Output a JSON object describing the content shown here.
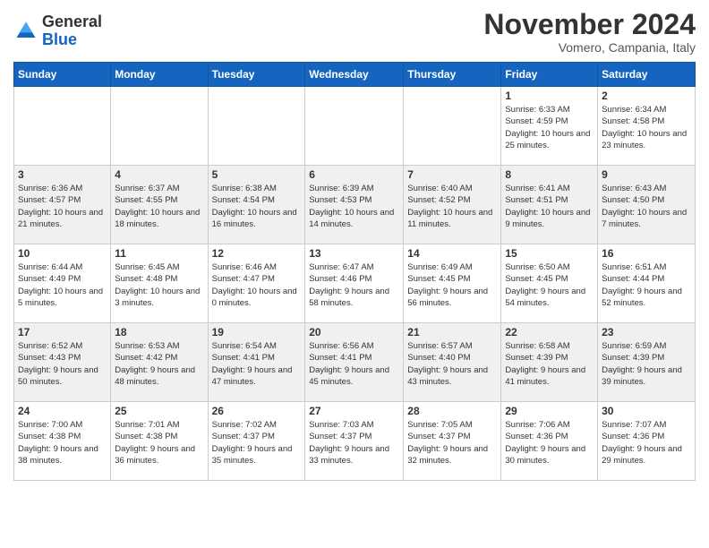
{
  "header": {
    "logo_line1": "General",
    "logo_line2": "Blue",
    "month": "November 2024",
    "location": "Vomero, Campania, Italy"
  },
  "weekdays": [
    "Sunday",
    "Monday",
    "Tuesday",
    "Wednesday",
    "Thursday",
    "Friday",
    "Saturday"
  ],
  "weeks": [
    [
      {
        "day": "",
        "info": ""
      },
      {
        "day": "",
        "info": ""
      },
      {
        "day": "",
        "info": ""
      },
      {
        "day": "",
        "info": ""
      },
      {
        "day": "",
        "info": ""
      },
      {
        "day": "1",
        "info": "Sunrise: 6:33 AM\nSunset: 4:59 PM\nDaylight: 10 hours\nand 25 minutes."
      },
      {
        "day": "2",
        "info": "Sunrise: 6:34 AM\nSunset: 4:58 PM\nDaylight: 10 hours\nand 23 minutes."
      }
    ],
    [
      {
        "day": "3",
        "info": "Sunrise: 6:36 AM\nSunset: 4:57 PM\nDaylight: 10 hours\nand 21 minutes."
      },
      {
        "day": "4",
        "info": "Sunrise: 6:37 AM\nSunset: 4:55 PM\nDaylight: 10 hours\nand 18 minutes."
      },
      {
        "day": "5",
        "info": "Sunrise: 6:38 AM\nSunset: 4:54 PM\nDaylight: 10 hours\nand 16 minutes."
      },
      {
        "day": "6",
        "info": "Sunrise: 6:39 AM\nSunset: 4:53 PM\nDaylight: 10 hours\nand 14 minutes."
      },
      {
        "day": "7",
        "info": "Sunrise: 6:40 AM\nSunset: 4:52 PM\nDaylight: 10 hours\nand 11 minutes."
      },
      {
        "day": "8",
        "info": "Sunrise: 6:41 AM\nSunset: 4:51 PM\nDaylight: 10 hours\nand 9 minutes."
      },
      {
        "day": "9",
        "info": "Sunrise: 6:43 AM\nSunset: 4:50 PM\nDaylight: 10 hours\nand 7 minutes."
      }
    ],
    [
      {
        "day": "10",
        "info": "Sunrise: 6:44 AM\nSunset: 4:49 PM\nDaylight: 10 hours\nand 5 minutes."
      },
      {
        "day": "11",
        "info": "Sunrise: 6:45 AM\nSunset: 4:48 PM\nDaylight: 10 hours\nand 3 minutes."
      },
      {
        "day": "12",
        "info": "Sunrise: 6:46 AM\nSunset: 4:47 PM\nDaylight: 10 hours\nand 0 minutes."
      },
      {
        "day": "13",
        "info": "Sunrise: 6:47 AM\nSunset: 4:46 PM\nDaylight: 9 hours\nand 58 minutes."
      },
      {
        "day": "14",
        "info": "Sunrise: 6:49 AM\nSunset: 4:45 PM\nDaylight: 9 hours\nand 56 minutes."
      },
      {
        "day": "15",
        "info": "Sunrise: 6:50 AM\nSunset: 4:45 PM\nDaylight: 9 hours\nand 54 minutes."
      },
      {
        "day": "16",
        "info": "Sunrise: 6:51 AM\nSunset: 4:44 PM\nDaylight: 9 hours\nand 52 minutes."
      }
    ],
    [
      {
        "day": "17",
        "info": "Sunrise: 6:52 AM\nSunset: 4:43 PM\nDaylight: 9 hours\nand 50 minutes."
      },
      {
        "day": "18",
        "info": "Sunrise: 6:53 AM\nSunset: 4:42 PM\nDaylight: 9 hours\nand 48 minutes."
      },
      {
        "day": "19",
        "info": "Sunrise: 6:54 AM\nSunset: 4:41 PM\nDaylight: 9 hours\nand 47 minutes."
      },
      {
        "day": "20",
        "info": "Sunrise: 6:56 AM\nSunset: 4:41 PM\nDaylight: 9 hours\nand 45 minutes."
      },
      {
        "day": "21",
        "info": "Sunrise: 6:57 AM\nSunset: 4:40 PM\nDaylight: 9 hours\nand 43 minutes."
      },
      {
        "day": "22",
        "info": "Sunrise: 6:58 AM\nSunset: 4:39 PM\nDaylight: 9 hours\nand 41 minutes."
      },
      {
        "day": "23",
        "info": "Sunrise: 6:59 AM\nSunset: 4:39 PM\nDaylight: 9 hours\nand 39 minutes."
      }
    ],
    [
      {
        "day": "24",
        "info": "Sunrise: 7:00 AM\nSunset: 4:38 PM\nDaylight: 9 hours\nand 38 minutes."
      },
      {
        "day": "25",
        "info": "Sunrise: 7:01 AM\nSunset: 4:38 PM\nDaylight: 9 hours\nand 36 minutes."
      },
      {
        "day": "26",
        "info": "Sunrise: 7:02 AM\nSunset: 4:37 PM\nDaylight: 9 hours\nand 35 minutes."
      },
      {
        "day": "27",
        "info": "Sunrise: 7:03 AM\nSunset: 4:37 PM\nDaylight: 9 hours\nand 33 minutes."
      },
      {
        "day": "28",
        "info": "Sunrise: 7:05 AM\nSunset: 4:37 PM\nDaylight: 9 hours\nand 32 minutes."
      },
      {
        "day": "29",
        "info": "Sunrise: 7:06 AM\nSunset: 4:36 PM\nDaylight: 9 hours\nand 30 minutes."
      },
      {
        "day": "30",
        "info": "Sunrise: 7:07 AM\nSunset: 4:36 PM\nDaylight: 9 hours\nand 29 minutes."
      }
    ]
  ]
}
